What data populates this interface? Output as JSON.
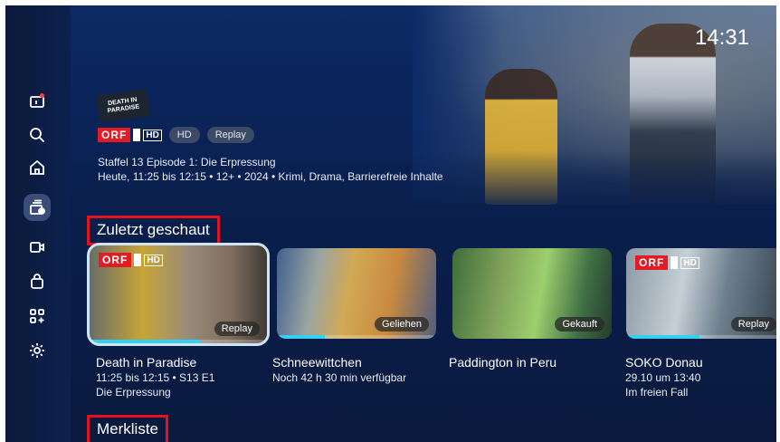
{
  "clock": "14:31",
  "hero": {
    "show_logo_text": "DEATH IN PARADISE",
    "channel_box": "ORF",
    "channel_hd": "HD",
    "badges": [
      "HD",
      "Replay"
    ],
    "episode_title": "Staffel 13 Episode 1: Die Erpressung",
    "meta": "Heute, 11:25 bis 12:15 • 12+ • 2024 • Krimi, Drama, Barrierefreie Inhalte"
  },
  "sidebar": {
    "items": [
      {
        "name": "tv-icon",
        "active": false
      },
      {
        "name": "search-icon",
        "active": false
      },
      {
        "name": "home-icon",
        "active": false
      },
      {
        "name": "library-icon",
        "active": true
      },
      {
        "name": "video-camera-icon",
        "active": false
      },
      {
        "name": "shop-bag-icon",
        "active": false
      },
      {
        "name": "apps-icon",
        "active": false
      },
      {
        "name": "settings-gear-icon",
        "active": false
      }
    ]
  },
  "sections": {
    "recent": "Zuletzt geschaut",
    "watchlist": "Merkliste"
  },
  "cards": [
    {
      "title": "Death in Paradise",
      "line2": "11:25 bis 12:15 • S13 E1",
      "line3": "Die Erpressung",
      "badge": "Replay",
      "channel": "ORF",
      "hd": "HD",
      "progress": 0.62
    },
    {
      "title": "Schneewittchen",
      "line2": "Noch 42 h 30 min verfügbar",
      "line3": "",
      "badge": "Geliehen",
      "progress": 0.3
    },
    {
      "title": "Paddington in Peru",
      "line2": "",
      "line3": "",
      "badge": "Gekauft",
      "progress": 0
    },
    {
      "title": "SOKO Donau",
      "line2": "29.10 um 13:40",
      "line3": "Im freien Fall",
      "badge": "Replay",
      "channel": "ORF",
      "hd": "HD",
      "progress": 0.45
    }
  ],
  "colors": {
    "accent": "#34d0f2",
    "highlight_border": "#e3121d",
    "brand_red": "#e31b23"
  }
}
